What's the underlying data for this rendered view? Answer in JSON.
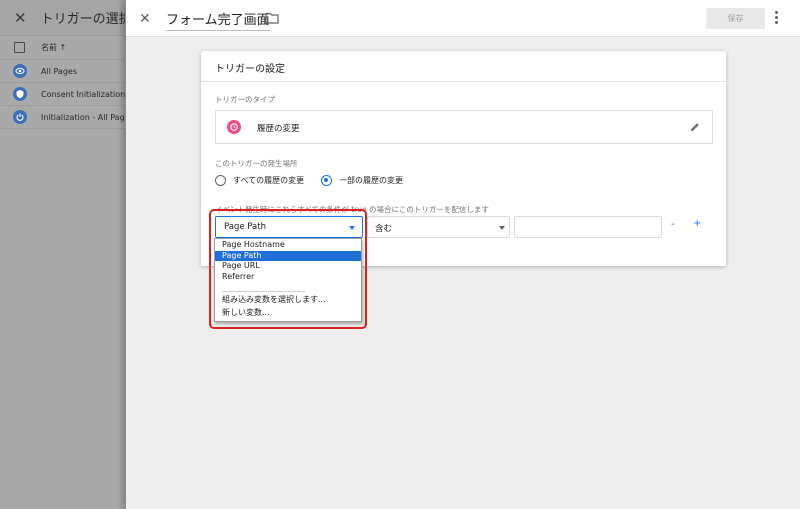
{
  "background_panel": {
    "title": "トリガーの選択",
    "column_name": "名前 ↑",
    "rows": [
      {
        "label": "All Pages",
        "icon": "eye-icon"
      },
      {
        "label": "Consent Initialization - All Pages",
        "icon": "shield-icon"
      },
      {
        "label": "Initialization - All Pages",
        "icon": "power-icon"
      }
    ]
  },
  "topbar": {
    "title": "フォーム完了画面",
    "save_label": "保存"
  },
  "card": {
    "title": "トリガーの設定",
    "type_label": "トリガーのタイプ",
    "type_value": "履歴の変更",
    "fires_on_label": "このトリガーの発生場所",
    "radio_all": "すべての履歴の変更",
    "radio_some": "一部の履歴の変更",
    "condition_label": "イベント発生時にこれらすべての条件が true の場合にこのトリガーを配信します",
    "variable_select": "Page Path",
    "operator_select": "含む",
    "value_input": "",
    "minus": "-",
    "plus": "+"
  },
  "dropdown": {
    "items": [
      "Page Hostname",
      "Page Path",
      "Page URL",
      "Referrer"
    ],
    "selected": "Page Path",
    "extra_items": [
      "組み込み変数を選択します...",
      "新しい変数..."
    ]
  },
  "colors": {
    "accent": "#1a73e8",
    "trigger_icon": "#e8508a",
    "highlight": "#e02020"
  }
}
